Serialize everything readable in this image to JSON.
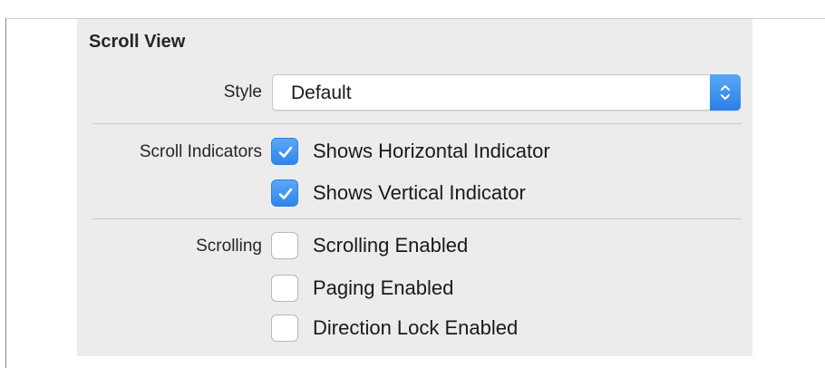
{
  "section_title": "Scroll View",
  "style": {
    "label": "Style",
    "selected": "Default"
  },
  "scroll_indicators": {
    "label": "Scroll Indicators",
    "options": [
      {
        "label": "Shows Horizontal Indicator",
        "checked": true
      },
      {
        "label": "Shows Vertical Indicator",
        "checked": true
      }
    ]
  },
  "scrolling": {
    "label": "Scrolling",
    "options": [
      {
        "label": "Scrolling Enabled",
        "checked": false
      },
      {
        "label": "Paging Enabled",
        "checked": false
      },
      {
        "label": "Direction Lock Enabled",
        "checked": false
      }
    ]
  },
  "icons": {
    "stepper": "up-down-chevron-icon",
    "checkmark": "checkmark-icon"
  },
  "colors": {
    "accent": "#2f86ea",
    "panel_background": "#ececec"
  }
}
